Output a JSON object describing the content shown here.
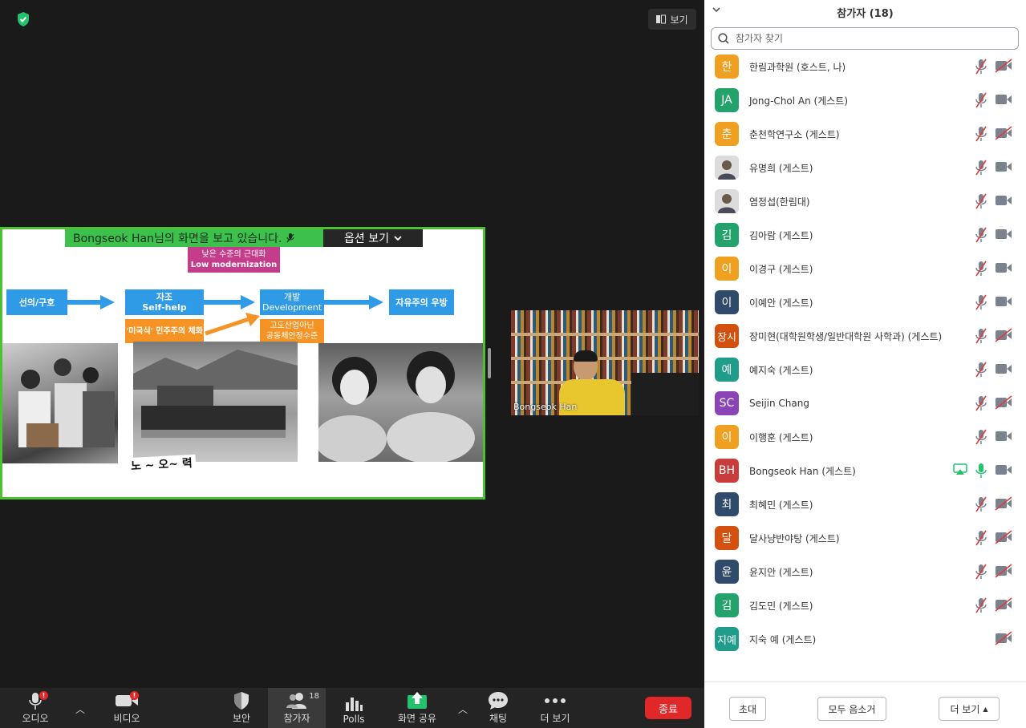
{
  "meeting": {
    "view_label": "보기",
    "banner_text": "Bongseok Han님의 화면을 보고 있습니다.",
    "options_label": "옵션 보기"
  },
  "slide": {
    "low_modernization_kr": "낮은 수준의 근대화",
    "low_modernization_en": "Low modernization",
    "step1": "선의/구호",
    "step2_kr": "자조",
    "step2_en": "Self-help",
    "step3_kr": "개발",
    "step3_en": "Development",
    "step4": "자유주의 우방",
    "note1": "'미국식' 민주주의 체화",
    "note2_line1": "고도산업아닌",
    "note2_line2": "공동체안정수준",
    "caption": "노 ~ 오~ 력"
  },
  "video": {
    "speaker_name": "Bongseok Han"
  },
  "toolbar": {
    "audio": "오디오",
    "video": "비디오",
    "security": "보안",
    "participants": "참가자",
    "participants_count": "18",
    "polls": "Polls",
    "share": "화면 공유",
    "chat": "채팅",
    "more": "더 보기",
    "end": "종료",
    "alert": "!"
  },
  "panel": {
    "title": "참가자 (18)",
    "search_placeholder": "참가자 찾기",
    "participants": [
      {
        "initials": "한",
        "name": "한림과학원 (호스트, 나)",
        "color": "#f0a020",
        "mic": "muted",
        "cam": "off"
      },
      {
        "initials": "JA",
        "name": "Jong-Chol An (게스트)",
        "color": "#23a36b",
        "mic": "muted",
        "cam": "on"
      },
      {
        "initials": "춘",
        "name": "춘천학연구소 (게스트)",
        "color": "#f0a020",
        "mic": "muted",
        "cam": "off"
      },
      {
        "initials": "",
        "name": "유명희 (게스트)",
        "color": "#c9c9c9",
        "mic": "muted",
        "cam": "on"
      },
      {
        "initials": "",
        "name": "염정섭(한림대)",
        "color": "#c9c9c9",
        "mic": "muted",
        "cam": "on"
      },
      {
        "initials": "김",
        "name": "김아람 (게스트)",
        "color": "#23a36b",
        "mic": "muted",
        "cam": "on"
      },
      {
        "initials": "이",
        "name": "이경구 (게스트)",
        "color": "#f0a020",
        "mic": "muted",
        "cam": "on"
      },
      {
        "initials": "이",
        "name": "이예안 (게스트)",
        "color": "#2f4a6b",
        "mic": "muted",
        "cam": "on"
      },
      {
        "initials": "장시",
        "name": "장미현(대학원학생/일반대학원 사학과) (게스트)",
        "color": "#d4500e",
        "mic": "muted",
        "cam": "off"
      },
      {
        "initials": "예",
        "name": "예지숙 (게스트)",
        "color": "#1f9c8a",
        "mic": "muted",
        "cam": "on"
      },
      {
        "initials": "SC",
        "name": "Seijin Chang",
        "color": "#8b44b8",
        "mic": "muted",
        "cam": "off"
      },
      {
        "initials": "이",
        "name": "이행훈 (게스트)",
        "color": "#f0a020",
        "mic": "muted",
        "cam": "on"
      },
      {
        "initials": "BH",
        "name": "Bongseok Han (게스트)",
        "color": "#c83c3c",
        "mic": "live",
        "cam": "on",
        "sharing": true
      },
      {
        "initials": "최",
        "name": "최혜민 (게스트)",
        "color": "#2f4a6b",
        "mic": "muted",
        "cam": "off"
      },
      {
        "initials": "달",
        "name": "달사냥반야탕 (게스트)",
        "color": "#d4500e",
        "mic": "muted",
        "cam": "off"
      },
      {
        "initials": "윤",
        "name": "윤지안 (게스트)",
        "color": "#2f4a6b",
        "mic": "muted",
        "cam": "off"
      },
      {
        "initials": "김",
        "name": "김도민 (게스트)",
        "color": "#23a36b",
        "mic": "muted",
        "cam": "off"
      },
      {
        "initials": "지예",
        "name": "지숙 예 (게스트)",
        "color": "#1f9c8a",
        "mic": "none",
        "cam": "off"
      }
    ],
    "invite": "초대",
    "mute_all": "모두 음소거",
    "more": "더 보기"
  },
  "colors": {
    "accent_green": "#4cc233",
    "end_red": "#e02828",
    "mute_red": "#e03c3c",
    "icon_gray": "#7a8290"
  }
}
